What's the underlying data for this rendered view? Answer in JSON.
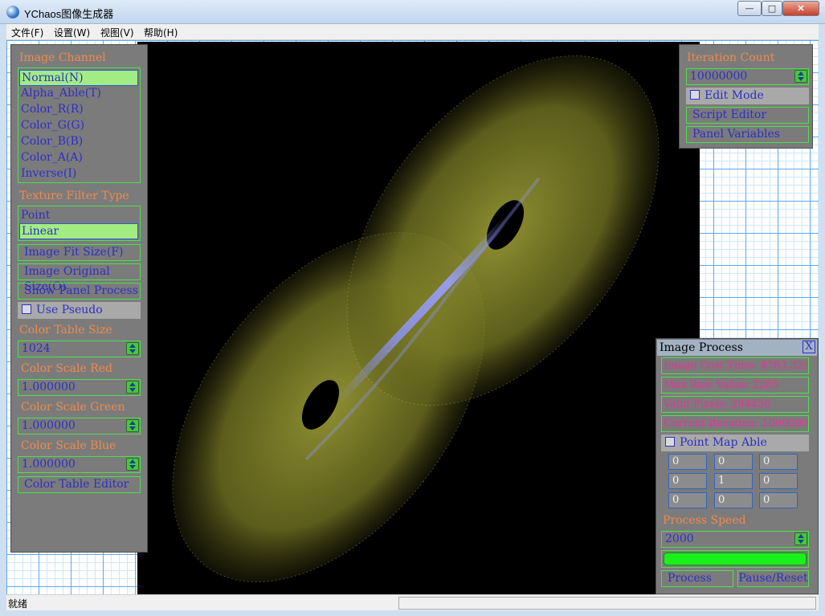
{
  "window": {
    "title": "YChaos图像生成器",
    "minimize_icon": "minimize-icon",
    "maximize_icon": "maximize-icon",
    "close_icon": "close-icon"
  },
  "menu": [
    "文件(F)",
    "设置(W)",
    "视图(V)",
    "帮助(H)"
  ],
  "status": {
    "text": "就绪"
  },
  "left_panel": {
    "image_channel_label": "Image Channel",
    "channels": [
      "Normal(N)",
      "Alpha_Able(T)",
      "Color_R(R)",
      "Color_G(G)",
      "Color_B(B)",
      "Color_A(A)",
      "Inverse(I)"
    ],
    "selected_channel": "Normal(N)",
    "texture_filter_label": "Texture Filter Type",
    "filters": [
      "Point",
      "Linear"
    ],
    "selected_filter": "Linear",
    "image_fit_size": "Image Fit Size(F)",
    "image_original_size": "Image Original Size(O)",
    "show_panel_process": "Show Panel Process",
    "use_pseudo": "Use Pseudo",
    "color_table_size_label": "Color Table Size",
    "color_table_size": "1024",
    "color_scale_red_label": "Color Scale Red",
    "color_scale_red": "1.000000",
    "color_scale_green_label": "Color Scale Green",
    "color_scale_green": "1.000000",
    "color_scale_blue_label": "Color Scale Blue",
    "color_scale_blue": "1.000000",
    "color_table_editor": "Color Table Editor"
  },
  "right_panel": {
    "iteration_count_label": "Iteration Count",
    "iteration_count": "10000000",
    "edit_mode": "Edit Mode",
    "script_editor": "Script Editor",
    "panel_variables": "Panel Variables"
  },
  "process_panel": {
    "title": "Image Process",
    "close_label": "X",
    "cost_time": "Image Cost Time: 4783.329",
    "max_raw": "Max Raw Value: 2285",
    "valid_pixels": "Valid Pixels: 294456",
    "current_iteration": "Current Iteration: 10000000",
    "point_map_able": "Point Map Able",
    "matrix": [
      [
        "0",
        "0",
        "0"
      ],
      [
        "0",
        "1",
        "0"
      ],
      [
        "0",
        "0",
        "0"
      ]
    ],
    "process_speed_label": "Process Speed",
    "process_speed": "2000",
    "progress": 1.0,
    "process_button": "Process",
    "pause_reset_button": "Pause/Reset"
  },
  "colors": {
    "panel_bg": "#7b7b7b",
    "accent_green": "#4ce14c",
    "header_orange": "#f08a4b",
    "text_blue": "#2e2ec7",
    "info_pink": "#e8329a",
    "attractor_olive": "#8a8c2a",
    "attractor_core": "#8f95ff"
  }
}
